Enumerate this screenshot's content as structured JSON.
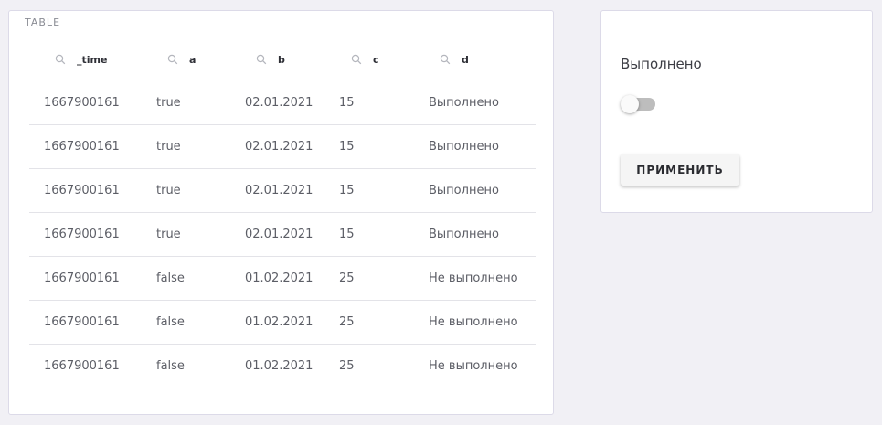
{
  "table": {
    "title": "TABLE",
    "columns": [
      "_time",
      "a",
      "b",
      "c",
      "d"
    ],
    "rows": [
      [
        "1667900161",
        "true",
        "02.01.2021",
        "15",
        "Выполнено"
      ],
      [
        "1667900161",
        "true",
        "02.01.2021",
        "15",
        "Выполнено"
      ],
      [
        "1667900161",
        "true",
        "02.01.2021",
        "15",
        "Выполнено"
      ],
      [
        "1667900161",
        "true",
        "02.01.2021",
        "15",
        "Выполнено"
      ],
      [
        "1667900161",
        "false",
        "01.02.2021",
        "25",
        "Не выполнено"
      ],
      [
        "1667900161",
        "false",
        "01.02.2021",
        "25",
        "Не выполнено"
      ],
      [
        "1667900161",
        "false",
        "01.02.2021",
        "25",
        "Не выполнено"
      ]
    ]
  },
  "filter": {
    "label": "Выполнено",
    "toggle_on": false,
    "apply_label": "ПРИМЕНИТЬ"
  },
  "icons": {
    "column_search": "search-icon"
  }
}
